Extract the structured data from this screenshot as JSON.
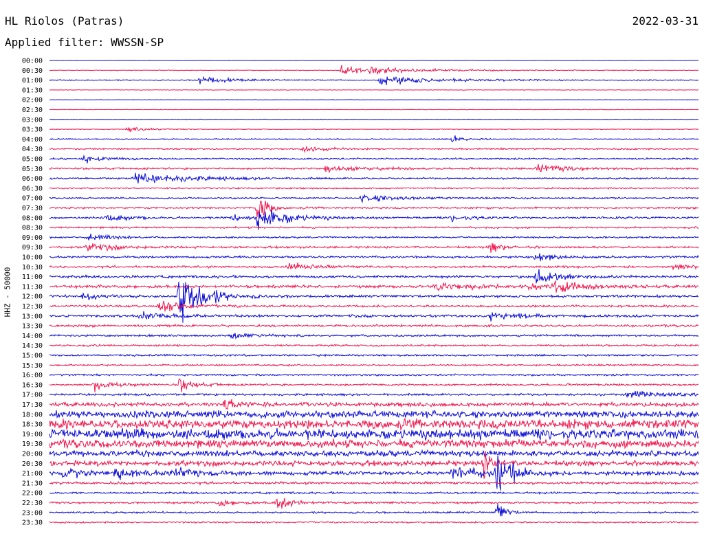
{
  "header": {
    "station": "HL Riolos (Patras)",
    "date": "2022-03-31",
    "filter": "Applied filter: WWSSN-SP"
  },
  "colors": {
    "even_hour": "#0a0ad6",
    "half_hour": "#f0124a"
  },
  "chart_data": {
    "type": "line",
    "title": "HL Riolos (Patras)",
    "subtitle": "Applied filter: WWSSN-SP",
    "ylabel": "HHZ - 50000",
    "xlabel": "",
    "grid": false,
    "legend": "none",
    "row_labels": [
      "00:00",
      "00:30",
      "01:00",
      "01:30",
      "02:00",
      "02:30",
      "03:00",
      "03:30",
      "04:00",
      "04:30",
      "05:00",
      "05:30",
      "06:00",
      "06:30",
      "07:00",
      "07:30",
      "08:00",
      "08:30",
      "09:00",
      "09:30",
      "10:00",
      "10:30",
      "11:00",
      "11:30",
      "12:00",
      "12:30",
      "13:00",
      "13:30",
      "14:00",
      "14:30",
      "15:00",
      "15:30",
      "16:00",
      "16:30",
      "17:00",
      "17:30",
      "18:00",
      "18:30",
      "19:00",
      "19:30",
      "20:00",
      "20:30",
      "21:00",
      "21:30",
      "22:00",
      "22:30",
      "23:00",
      "23:30"
    ],
    "noise_level": [
      0.4,
      0.6,
      1,
      0.5,
      0.5,
      0.5,
      0.6,
      0.7,
      1,
      1.6,
      1.6,
      1.8,
      1.6,
      1.4,
      1.5,
      1.8,
      2,
      1.8,
      1.8,
      2,
      2.2,
      2.2,
      2.5,
      2.8,
      2.5,
      2.2,
      2.5,
      2.2,
      2,
      1.9,
      1.8,
      1.8,
      1.8,
      2,
      2.2,
      4,
      7,
      9,
      10,
      8,
      6,
      5,
      4,
      2.5,
      2,
      2,
      1.8,
      1.6
    ],
    "events": [
      {
        "row": 1,
        "x": 0.45,
        "amp": 10,
        "dur": 0.03
      },
      {
        "row": 1,
        "x": 0.49,
        "amp": 6,
        "dur": 0.1
      },
      {
        "row": 2,
        "x": 0.23,
        "amp": 9,
        "dur": 0.04
      },
      {
        "row": 2,
        "x": 0.51,
        "amp": 10,
        "dur": 0.08
      },
      {
        "row": 7,
        "x": 0.12,
        "amp": 6,
        "dur": 0.03
      },
      {
        "row": 8,
        "x": 0.62,
        "amp": 8,
        "dur": 0.02
      },
      {
        "row": 9,
        "x": 0.39,
        "amp": 7,
        "dur": 0.03
      },
      {
        "row": 10,
        "x": 0.05,
        "amp": 8,
        "dur": 0.03
      },
      {
        "row": 11,
        "x": 0.42,
        "amp": 7,
        "dur": 0.06
      },
      {
        "row": 11,
        "x": 0.75,
        "amp": 8,
        "dur": 0.05
      },
      {
        "row": 12,
        "x": 0.13,
        "amp": 12,
        "dur": 0.08
      },
      {
        "row": 14,
        "x": 0.48,
        "amp": 8,
        "dur": 0.06
      },
      {
        "row": 15,
        "x": 0.32,
        "amp": 60,
        "dur": 0.01
      },
      {
        "row": 16,
        "x": 0.32,
        "amp": 28,
        "dur": 0.04
      },
      {
        "row": 16,
        "x": 0.08,
        "amp": 6,
        "dur": 0.04
      },
      {
        "row": 16,
        "x": 0.28,
        "amp": 8,
        "dur": 0.02
      },
      {
        "row": 16,
        "x": 0.62,
        "amp": 6,
        "dur": 0.03
      },
      {
        "row": 18,
        "x": 0.06,
        "amp": 8,
        "dur": 0.03
      },
      {
        "row": 19,
        "x": 0.06,
        "amp": 8,
        "dur": 0.04
      },
      {
        "row": 19,
        "x": 0.68,
        "amp": 10,
        "dur": 0.02
      },
      {
        "row": 20,
        "x": 0.75,
        "amp": 10,
        "dur": 0.02
      },
      {
        "row": 21,
        "x": 0.37,
        "amp": 7,
        "dur": 0.03
      },
      {
        "row": 21,
        "x": 0.96,
        "amp": 8,
        "dur": 0.02
      },
      {
        "row": 22,
        "x": 0.75,
        "amp": 14,
        "dur": 0.03
      },
      {
        "row": 23,
        "x": 0.74,
        "amp": 8,
        "dur": 0.02
      },
      {
        "row": 23,
        "x": 0.59,
        "amp": 9,
        "dur": 0.05
      },
      {
        "row": 23,
        "x": 0.78,
        "amp": 14,
        "dur": 0.04
      },
      {
        "row": 24,
        "x": 0.2,
        "amp": 70,
        "dur": 0.03
      },
      {
        "row": 24,
        "x": 0.05,
        "amp": 6,
        "dur": 0.03
      },
      {
        "row": 25,
        "x": 0.17,
        "amp": 10,
        "dur": 0.04
      },
      {
        "row": 26,
        "x": 0.14,
        "amp": 9,
        "dur": 0.04
      },
      {
        "row": 26,
        "x": 0.68,
        "amp": 8,
        "dur": 0.04
      },
      {
        "row": 28,
        "x": 0.28,
        "amp": 8,
        "dur": 0.03
      },
      {
        "row": 33,
        "x": 0.07,
        "amp": 12,
        "dur": 0.02
      },
      {
        "row": 33,
        "x": 0.2,
        "amp": 14,
        "dur": 0.02
      },
      {
        "row": 34,
        "x": 0.89,
        "amp": 9,
        "dur": 0.05
      },
      {
        "row": 35,
        "x": 0.27,
        "amp": 14,
        "dur": 0.02
      },
      {
        "row": 41,
        "x": 0.67,
        "amp": 30,
        "dur": 0.01
      },
      {
        "row": 42,
        "x": 0.02,
        "amp": 10,
        "dur": 0.04
      },
      {
        "row": 42,
        "x": 0.1,
        "amp": 10,
        "dur": 0.04
      },
      {
        "row": 42,
        "x": 0.19,
        "amp": 12,
        "dur": 0.03
      },
      {
        "row": 42,
        "x": 0.62,
        "amp": 12,
        "dur": 0.05
      },
      {
        "row": 42,
        "x": 0.69,
        "amp": 50,
        "dur": 0.02
      },
      {
        "row": 45,
        "x": 0.26,
        "amp": 8,
        "dur": 0.02
      },
      {
        "row": 45,
        "x": 0.35,
        "amp": 18,
        "dur": 0.02
      },
      {
        "row": 46,
        "x": 0.69,
        "amp": 30,
        "dur": 0.01
      }
    ]
  }
}
